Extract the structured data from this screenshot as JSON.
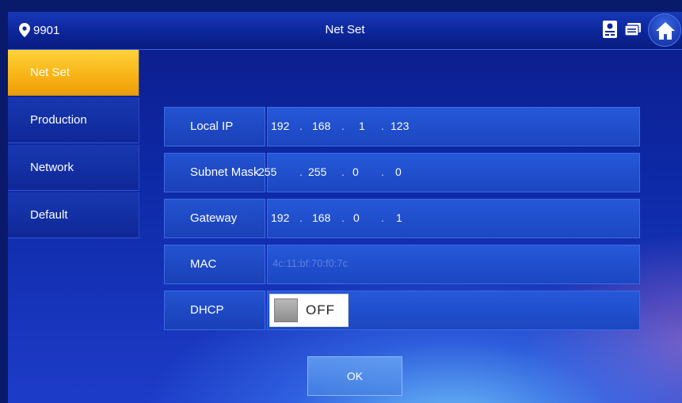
{
  "header": {
    "room_number": "9901",
    "title": "Net Set"
  },
  "sidebar": {
    "items": [
      {
        "label": "Net Set",
        "active": true
      },
      {
        "label": "Production",
        "active": false
      },
      {
        "label": "Network",
        "active": false
      },
      {
        "label": "Default",
        "active": false
      }
    ]
  },
  "form": {
    "local_ip": {
      "label": "Local IP",
      "octets": [
        "192",
        "168",
        "1",
        "123"
      ]
    },
    "subnet_mask": {
      "label": "Subnet Mask",
      "octets": [
        "255",
        "255",
        "0",
        "0"
      ]
    },
    "gateway": {
      "label": "Gateway",
      "octets": [
        "192",
        "168",
        "0",
        "1"
      ]
    },
    "mac": {
      "label": "MAC",
      "value": "4c:11:bf:70:f0:7c"
    },
    "dhcp": {
      "label": "DHCP",
      "state": "OFF"
    }
  },
  "ok_label": "OK",
  "icons": {
    "location": "map-pin-icon",
    "card": "id-card-icon",
    "message": "message-icon",
    "home": "home-icon"
  },
  "colors": {
    "accent_active": "#f7b214",
    "background": "#0e2aa8"
  }
}
